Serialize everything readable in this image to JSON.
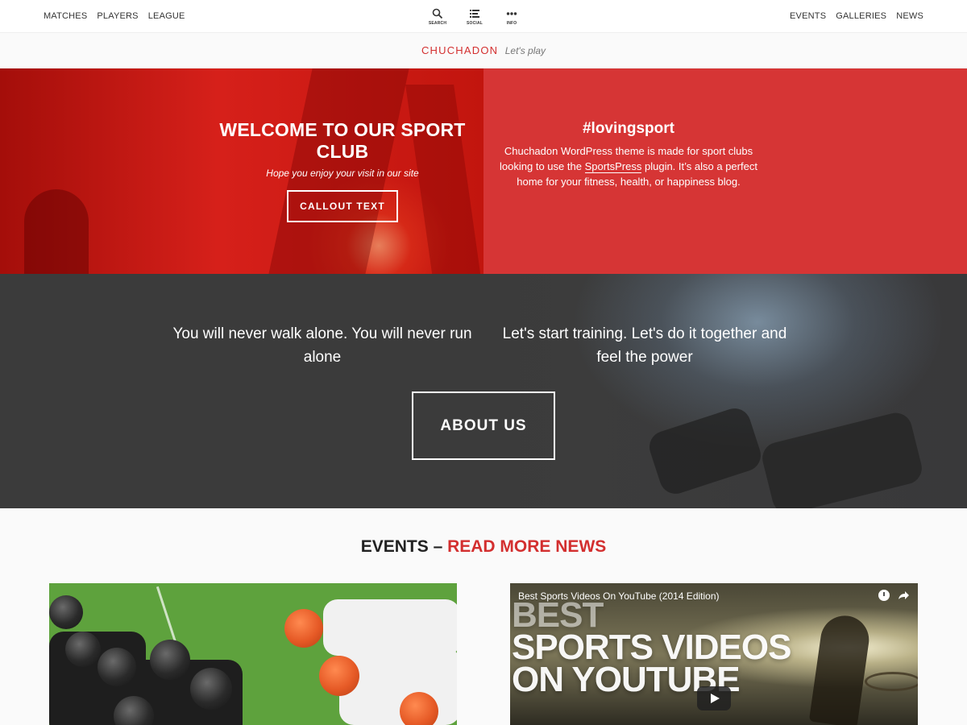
{
  "nav": {
    "left": [
      "MATCHES",
      "PLAYERS",
      "LEAGUE"
    ],
    "icons": [
      {
        "icon": "search-icon",
        "label": "SEARCH"
      },
      {
        "icon": "social-icon",
        "label": "SOCIAL"
      },
      {
        "icon": "info-icon",
        "label": "INFO"
      }
    ],
    "right": [
      "EVENTS",
      "GALLERIES",
      "NEWS"
    ]
  },
  "brand": {
    "name": "CHUCHADON",
    "tagline": "Let's play"
  },
  "hero": {
    "title": "WELCOME TO OUR SPORT CLUB",
    "subtitle": "Hope you enjoy your visit in our site",
    "callout_label": "CALLOUT TEXT",
    "hashtag": "#lovingsport",
    "text_before_link": "Chuchadon WordPress theme is made for sport clubs looking to use the ",
    "link_text": "SportsPress",
    "text_after_link": " plugin. It’s also a perfect home for your fitness, health, or happiness blog."
  },
  "dark_section": {
    "quote_left": "You will never walk alone. You will never run alone",
    "quote_right": "Let's start training. Let's do it together and feel the power",
    "about_label": "ABOUT US"
  },
  "events": {
    "heading_part1": "EVENTS – ",
    "heading_part2": "READ MORE NEWS",
    "video_title": "Best Sports Videos On YouTube (2014 Edition)",
    "video_big_lines": [
      "BEST",
      "SPORTS VIDEOS",
      "ON YOUTUBE"
    ]
  },
  "colors": {
    "accent": "#d32f2f",
    "hero_right": "#d63535",
    "dark": "#3b3b3b"
  }
}
